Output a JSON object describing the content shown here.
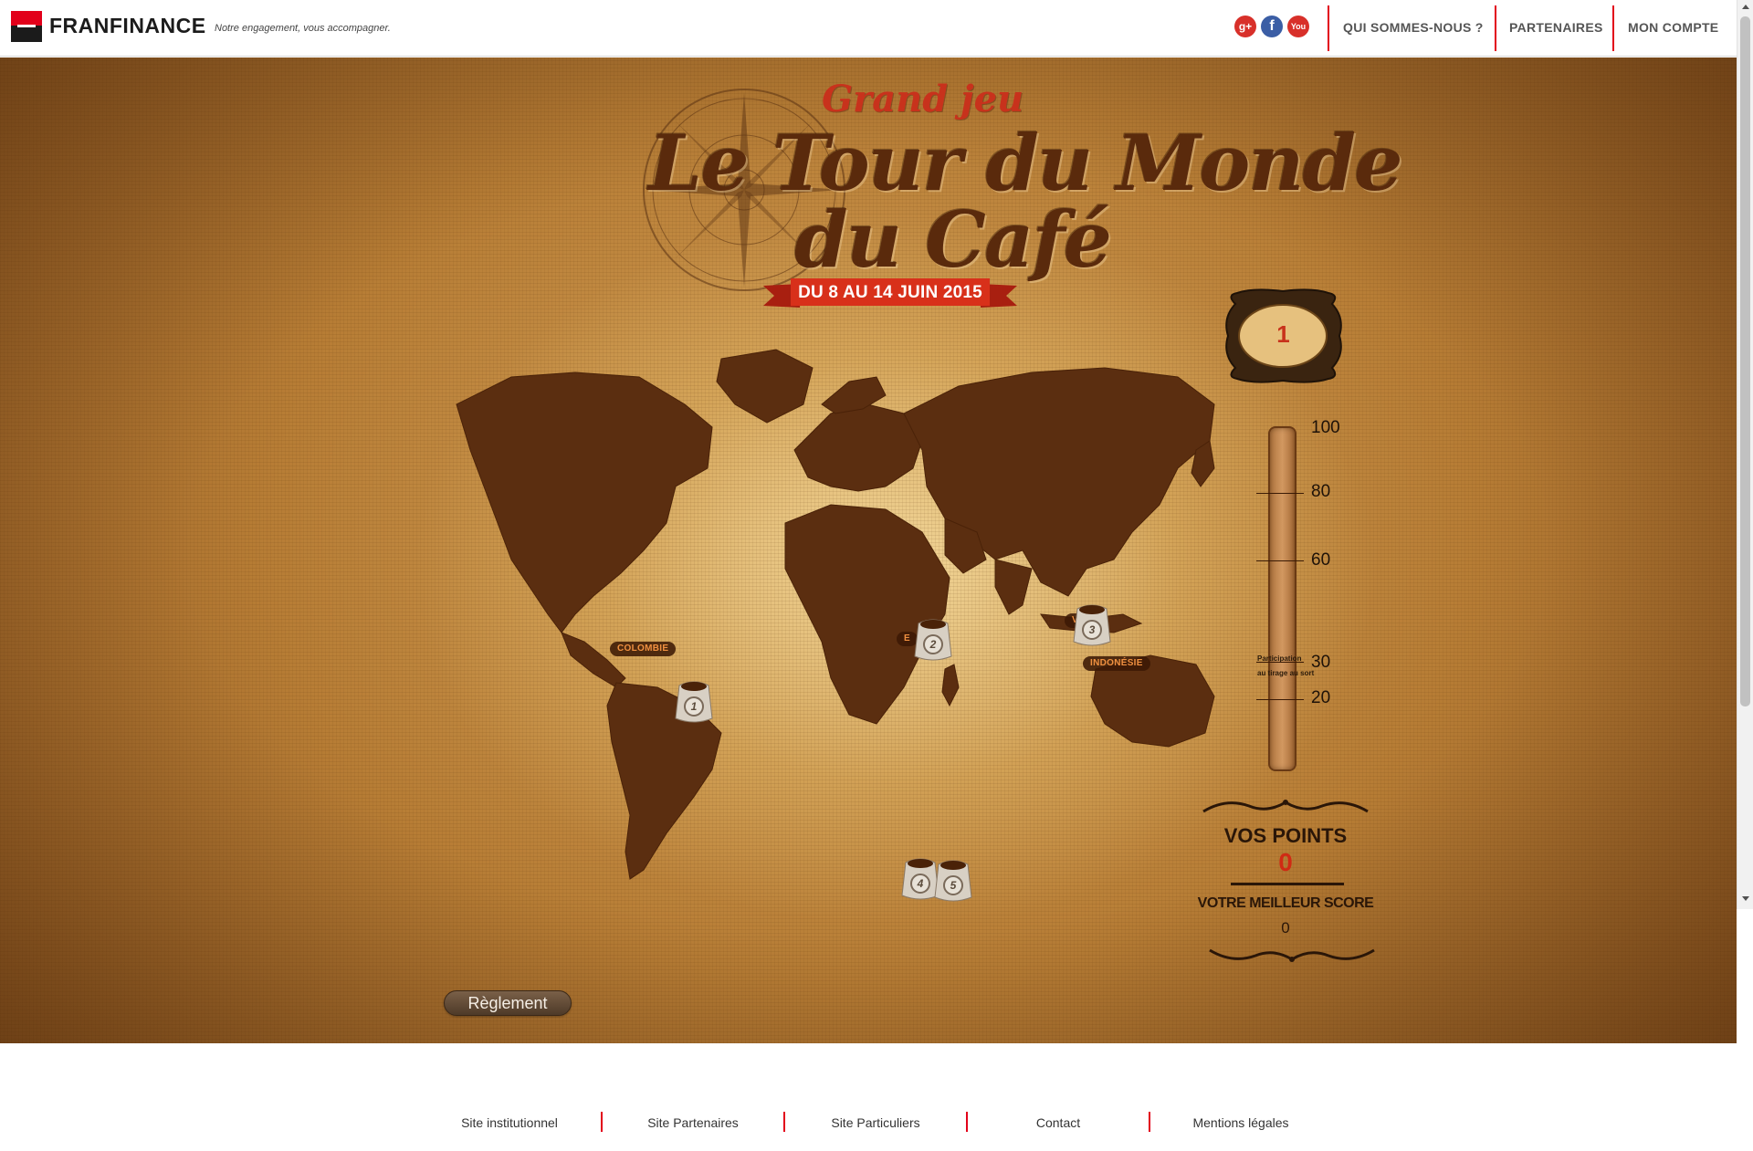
{
  "header": {
    "brand": "FRANFINANCE",
    "tagline": "Notre engagement, vous accompagner.",
    "social": [
      {
        "name": "google-plus",
        "glyph": "g+",
        "color": "#d8302a"
      },
      {
        "name": "facebook",
        "glyph": "f",
        "color": "#3b5ea5"
      },
      {
        "name": "youtube",
        "glyph": "You",
        "color": "#d8302a"
      }
    ],
    "nav": [
      "QUI SOMMES-NOUS ?",
      "PARTENAIRES",
      "MON COMPTE"
    ]
  },
  "game": {
    "subtitle": "Grand jeu",
    "title_line1": "Le Tour du Monde",
    "title_line2": "du Café",
    "dates": "DU 8 AU 14 JUIN 2015",
    "level": "1",
    "countries": [
      "COLOMBIE",
      "E",
      "V",
      "INDONÉSIE"
    ],
    "sacks": [
      "1",
      "2",
      "3",
      "4",
      "5"
    ],
    "gauge": {
      "ticks": [
        "100",
        "80",
        "60",
        "30",
        "20"
      ],
      "caption_line1": "Participation",
      "caption_line2": "au tirage au sort"
    },
    "points_label": "VOS POINTS",
    "points_value": "0",
    "best_label": "VOTRE MEILLEUR SCORE",
    "best_value": "0",
    "reglement": "Règlement"
  },
  "footer": {
    "links": [
      "Site institutionnel",
      "Site Partenaires",
      "Site Particuliers",
      "Contact",
      "Mentions légales"
    ]
  },
  "colors": {
    "brand_red": "#e2001a",
    "accent_red": "#c8321c",
    "coffee_brown": "#5a2a0c"
  }
}
